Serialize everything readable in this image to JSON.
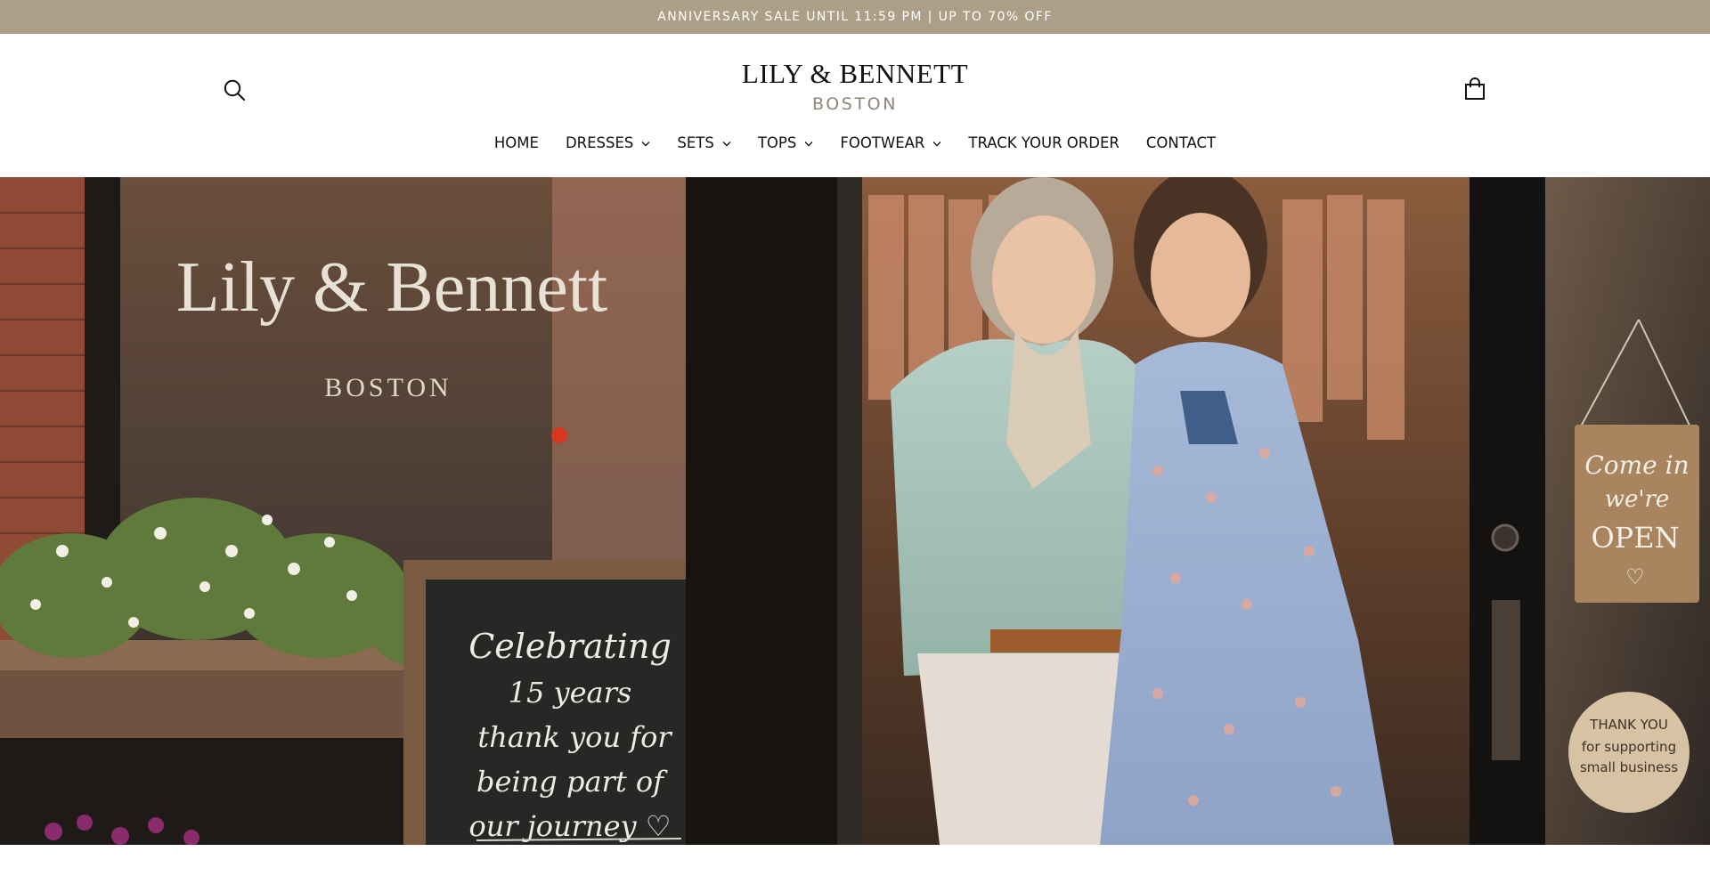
{
  "announcement": {
    "text": "ANNIVERSARY SALE UNTIL 11:59 PM | UP TO 70% OFF"
  },
  "header": {
    "logo": {
      "name": "LILY & BENNETT",
      "city": "BOSTON"
    },
    "icons": {
      "search": "search-icon",
      "cart": "shopping-bag-icon"
    }
  },
  "nav": {
    "items": [
      {
        "label": "HOME",
        "dropdown": false
      },
      {
        "label": "DRESSES",
        "dropdown": true
      },
      {
        "label": "SETS",
        "dropdown": true
      },
      {
        "label": "TOPS",
        "dropdown": true
      },
      {
        "label": "FOOTWEAR",
        "dropdown": true
      },
      {
        "label": "TRACK YOUR ORDER",
        "dropdown": false
      },
      {
        "label": "CONTACT",
        "dropdown": false
      }
    ]
  },
  "hero": {
    "window_lettering": {
      "name": "Lily & Bennett",
      "city": "BOSTON"
    },
    "chalkboard_lines": [
      "Celebrating",
      "15 years",
      "thank you for",
      "being part of",
      "our journey ♡"
    ],
    "door_sign_lines": [
      "Come in",
      "we're",
      "OPEN",
      "♡"
    ],
    "sticker_lines": [
      "THANK YOU",
      "for supporting",
      "small business"
    ]
  },
  "colors": {
    "announcement_bg": "#ac9e87",
    "logo_city": "#8f8577",
    "text": "#111111"
  }
}
